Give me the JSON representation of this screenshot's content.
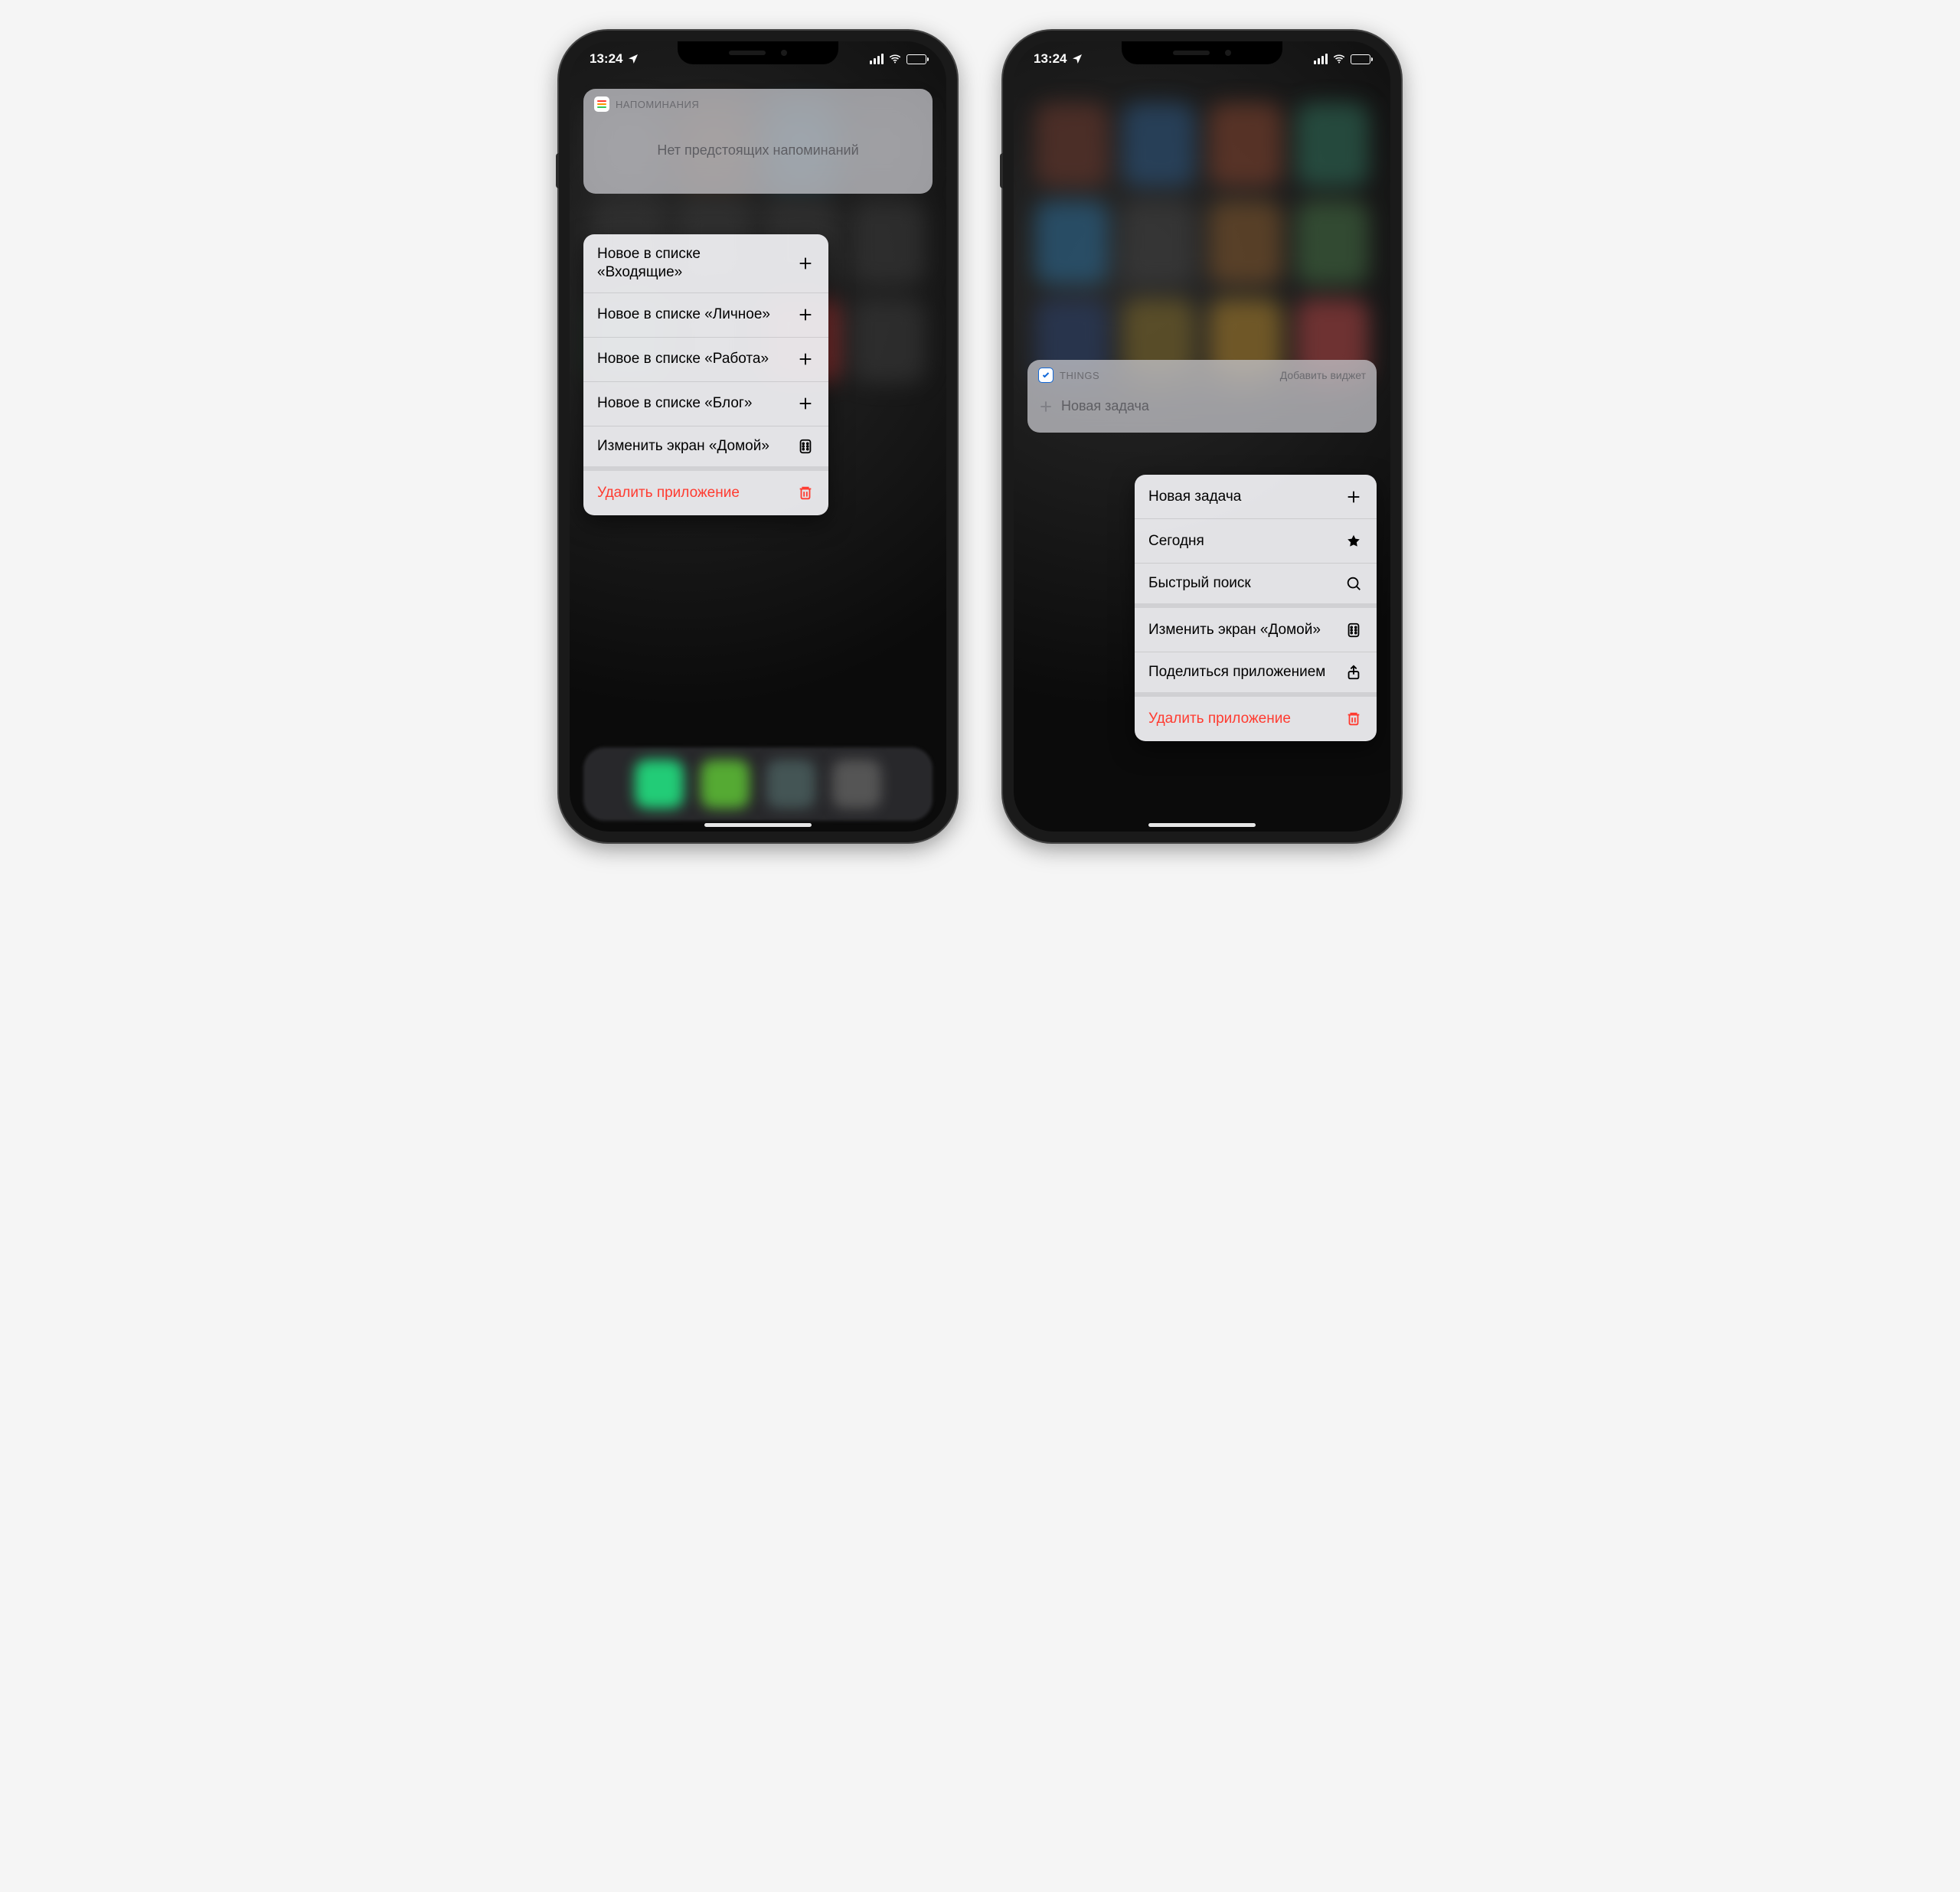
{
  "status": {
    "time": "13:24"
  },
  "left": {
    "widget": {
      "app_name": "НАПОМИНАНИЯ",
      "empty_text": "Нет предстоящих напоминаний"
    },
    "menu": [
      {
        "label": "Новое в списке «Входящие»",
        "icon": "plus"
      },
      {
        "label": "Новое в списке «Личное»",
        "icon": "plus"
      },
      {
        "label": "Новое в списке «Работа»",
        "icon": "plus"
      },
      {
        "label": "Новое в списке «Блог»",
        "icon": "plus"
      },
      {
        "label": "Изменить экран «Домой»",
        "icon": "apps",
        "sep": true
      },
      {
        "label": "Удалить приложение",
        "icon": "trash",
        "red": true
      }
    ]
  },
  "right": {
    "widget": {
      "app_name": "THINGS",
      "add_widget": "Добавить виджет",
      "new_task": "Новая задача"
    },
    "menu": [
      {
        "label": "Новая задача",
        "icon": "plus"
      },
      {
        "label": "Сегодня",
        "icon": "star"
      },
      {
        "label": "Быстрый поиск",
        "icon": "search",
        "sep": true
      },
      {
        "label": "Изменить экран «Домой»",
        "icon": "apps"
      },
      {
        "label": "Поделиться приложением",
        "icon": "share",
        "sep": true
      },
      {
        "label": "Удалить приложение",
        "icon": "trash",
        "red": true
      }
    ]
  }
}
